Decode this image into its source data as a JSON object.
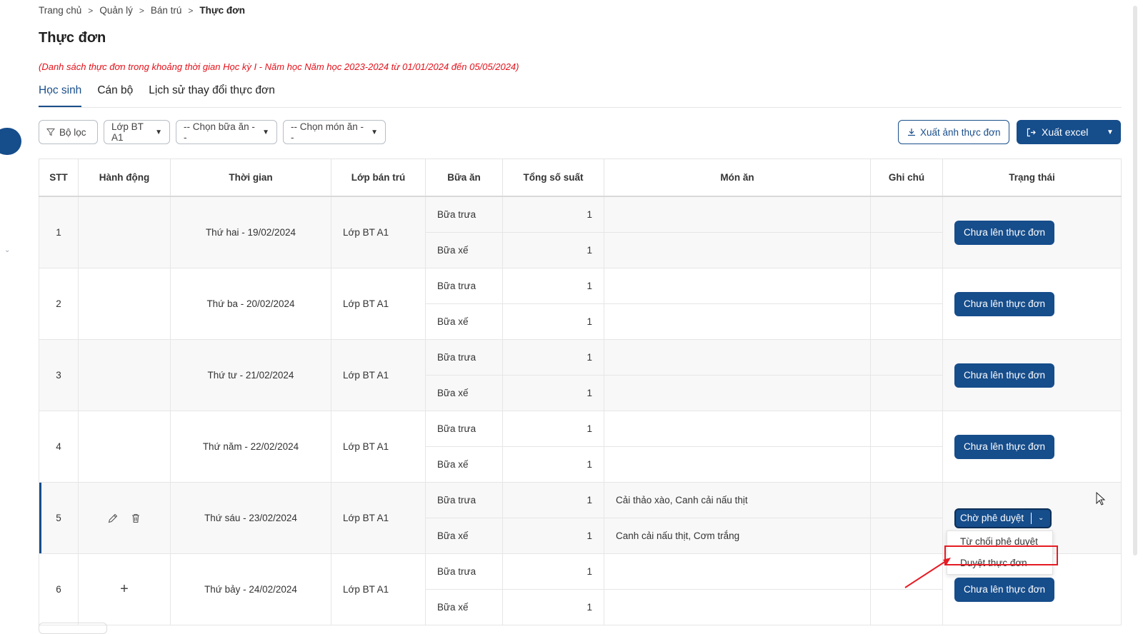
{
  "breadcrumb": {
    "items": [
      "Trang chủ",
      "Quản lý",
      "Bán trú"
    ],
    "current": "Thực đơn",
    "separator": ">"
  },
  "page": {
    "title": "Thực đơn",
    "note": "(Danh sách thực đơn trong khoảng thời gian Học kỳ I - Năm học Năm học 2023-2024 từ 01/01/2024 đến 05/05/2024)"
  },
  "tabs": [
    {
      "label": "Học sinh",
      "active": true
    },
    {
      "label": "Cán bộ",
      "active": false
    },
    {
      "label": "Lịch sử thay đổi thực đơn",
      "active": false
    }
  ],
  "toolbar": {
    "filter_label": "Bộ lọc",
    "class_select": "Lớp BT A1",
    "meal_select": "-- Chọn bữa ăn --",
    "dish_select": "-- Chọn món ăn --",
    "export_image_label": "Xuất ảnh thực đơn",
    "export_excel_label": "Xuất excel"
  },
  "table": {
    "headers": [
      "STT",
      "Hành động",
      "Thời gian",
      "Lớp bán trú",
      "Bữa ăn",
      "Tổng số suất",
      "Món ăn",
      "Ghi chú",
      "Trạng thái"
    ],
    "rows": [
      {
        "stt": "1",
        "time": "Thứ hai - 19/02/2024",
        "class": "Lớp BT A1",
        "meals": [
          {
            "name": "Bữa trưa",
            "count": "1",
            "dishes": ""
          },
          {
            "name": "Bữa xế",
            "count": "1",
            "dishes": ""
          }
        ],
        "status": "Chưa lên thực đơn"
      },
      {
        "stt": "2",
        "time": "Thứ ba - 20/02/2024",
        "class": "Lớp BT A1",
        "meals": [
          {
            "name": "Bữa trưa",
            "count": "1",
            "dishes": ""
          },
          {
            "name": "Bữa xế",
            "count": "1",
            "dishes": ""
          }
        ],
        "status": "Chưa lên thực đơn"
      },
      {
        "stt": "3",
        "time": "Thứ tư - 21/02/2024",
        "class": "Lớp BT A1",
        "meals": [
          {
            "name": "Bữa trưa",
            "count": "1",
            "dishes": ""
          },
          {
            "name": "Bữa xế",
            "count": "1",
            "dishes": ""
          }
        ],
        "status": "Chưa lên thực đơn"
      },
      {
        "stt": "4",
        "time": "Thứ năm - 22/02/2024",
        "class": "Lớp BT A1",
        "meals": [
          {
            "name": "Bữa trưa",
            "count": "1",
            "dishes": ""
          },
          {
            "name": "Bữa xế",
            "count": "1",
            "dishes": ""
          }
        ],
        "status": "Chưa lên thực đơn"
      },
      {
        "stt": "5",
        "time": "Thứ sáu - 23/02/2024",
        "class": "Lớp BT A1",
        "meals": [
          {
            "name": "Bữa trưa",
            "count": "1",
            "dishes": "Cải thảo xào, Canh cải nấu thịt"
          },
          {
            "name": "Bữa xế",
            "count": "1",
            "dishes": "Canh cải nấu thịt, Cơm trắng"
          }
        ],
        "status": "Chờ phê duyệt"
      },
      {
        "stt": "6",
        "time": "Thứ bảy - 24/02/2024",
        "class": "Lớp BT A1",
        "meals": [
          {
            "name": "Bữa trưa",
            "count": "1",
            "dishes": ""
          },
          {
            "name": "Bữa xế",
            "count": "1",
            "dishes": ""
          }
        ],
        "status": "Chưa lên thực đơn"
      }
    ]
  },
  "status_dropdown": {
    "items": [
      "Từ chối phê duyệt",
      "Duyệt thực đơn"
    ],
    "highlighted": "Duyệt thực đơn"
  },
  "icons": [
    "filter-icon",
    "chevron-down-icon",
    "download-icon",
    "sign-out-icon",
    "edit-icon",
    "trash-icon",
    "plus-icon",
    "cursor-icon"
  ],
  "colors": {
    "primary": "#164d8b",
    "note_red": "#e3121b",
    "highlight_red": "#e61b23"
  }
}
